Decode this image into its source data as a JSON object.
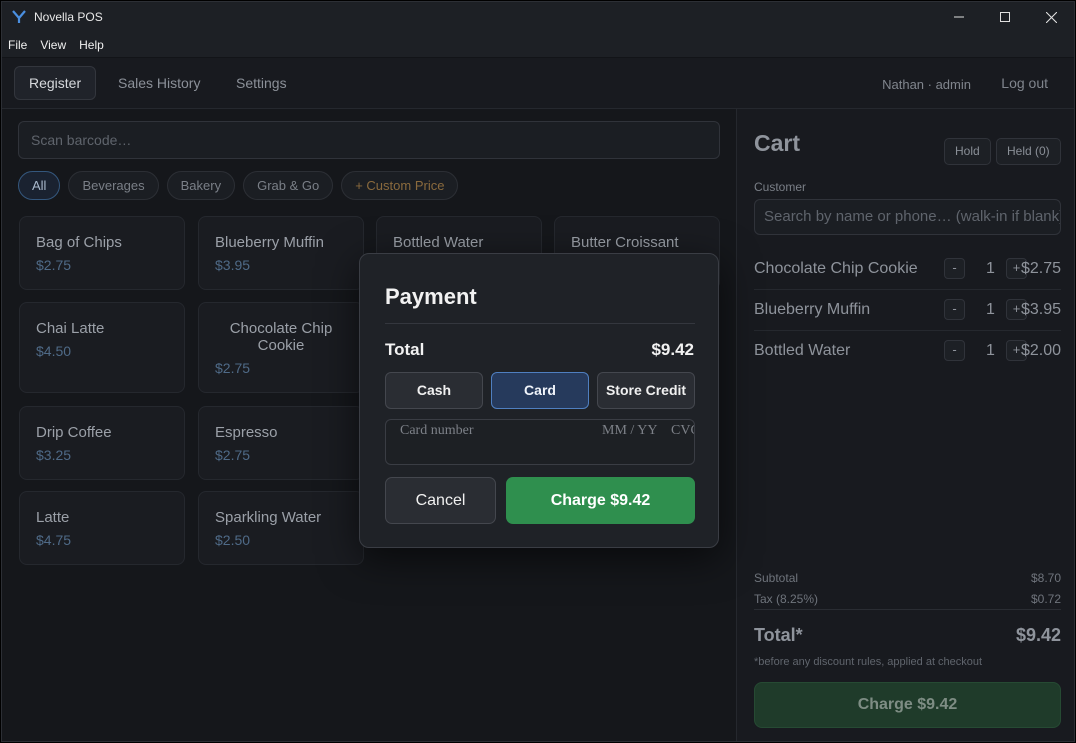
{
  "window": {
    "title": "Novella POS",
    "icons": {
      "logo": "novella-logo-icon",
      "minimize": "minimize-icon",
      "maximize": "maximize-icon",
      "close": "close-icon"
    }
  },
  "menu": {
    "items": [
      "File",
      "View",
      "Help"
    ]
  },
  "nav": {
    "tabs": [
      "Register",
      "Sales History",
      "Settings"
    ],
    "active_tab": "Register",
    "user": "Nathan · admin",
    "logout": "Log out"
  },
  "catalog": {
    "search_placeholder": "Scan barcode…",
    "categories": [
      "All",
      "Beverages",
      "Bakery",
      "Grab & Go",
      "+ Custom Price"
    ],
    "active_category": "All",
    "products": [
      {
        "name": "Bag of Chips",
        "price": "$2.75"
      },
      {
        "name": "Blueberry Muffin",
        "price": "$3.95"
      },
      {
        "name": "Bottled Water",
        "price": ""
      },
      {
        "name": "Butter Croissant",
        "price": ""
      },
      {
        "name": "Chai Latte",
        "price": "$4.50"
      },
      {
        "name": "Chocolate Chip Cookie",
        "price": "$2.75"
      },
      {
        "name": "Drip Coffee",
        "price": "$3.25"
      },
      {
        "name": "Espresso",
        "price": "$2.75"
      },
      {
        "name": "Latte",
        "price": "$4.75"
      },
      {
        "name": "Sparkling Water",
        "price": "$2.50"
      }
    ]
  },
  "cart": {
    "title": "Cart",
    "hold_label": "Hold",
    "held_label": "Held (0)",
    "customer_label": "Customer",
    "customer_placeholder": "Search by name or phone… (walk-in if blank)",
    "items": [
      {
        "name": "Chocolate Chip Cookie",
        "qty": "1",
        "price": "$2.75"
      },
      {
        "name": "Blueberry Muffin",
        "qty": "1",
        "price": "$3.95"
      },
      {
        "name": "Bottled Water",
        "qty": "1",
        "price": "$2.00"
      }
    ],
    "qty_minus": "-",
    "qty_plus": "+",
    "subtotal_label": "Subtotal",
    "subtotal": "$8.70",
    "tax_label": "Tax (8.25%)",
    "tax": "$0.72",
    "total_label": "Total*",
    "total": "$9.42",
    "note": "*before any discount rules, applied at checkout",
    "charge_label": "Charge $9.42"
  },
  "payment": {
    "title": "Payment",
    "total_label": "Total",
    "total": "$9.42",
    "methods": [
      "Cash",
      "Card",
      "Store Credit"
    ],
    "active_method": "Card",
    "card_number_placeholder": "Card number",
    "expiry_placeholder": "MM / YY",
    "cvc_placeholder": "CVC",
    "cancel_label": "Cancel",
    "charge_label": "Charge $9.42"
  },
  "colors": {
    "accent_blue": "#4f7fc0",
    "charge_green": "#2f8f4e",
    "background": "#14161a"
  }
}
